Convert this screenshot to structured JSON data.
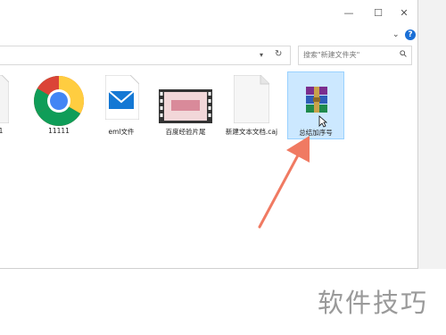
{
  "window": {
    "controls": {
      "minimize": "—",
      "maximize": "☐",
      "close": "✕"
    },
    "help": "?"
  },
  "search": {
    "placeholder": "搜索\"新建文件夹\""
  },
  "files": [
    {
      "label": "1",
      "icon": "generic-file-icon"
    },
    {
      "label": "11111",
      "icon": "chrome-icon"
    },
    {
      "label": "eml文件",
      "icon": "mail-icon"
    },
    {
      "label": "百度经验片尾",
      "icon": "video-thumbnail-icon"
    },
    {
      "label": "新建文本文档.caj",
      "icon": "document-icon"
    },
    {
      "label": "总结加序号",
      "icon": "winrar-archive-icon",
      "selected": true
    }
  ],
  "watermark": "软件技巧",
  "colors": {
    "arrow": "#f07a62",
    "selection": "#cce8ff",
    "help": "#1a6fd6"
  }
}
